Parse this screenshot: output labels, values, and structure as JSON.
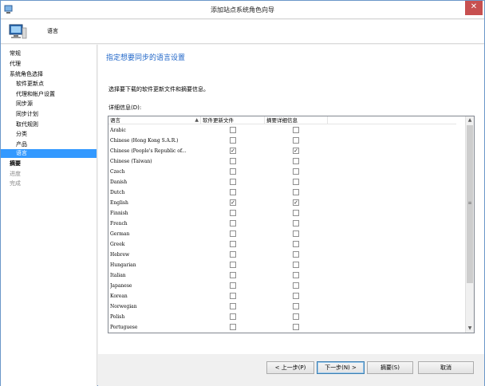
{
  "window": {
    "title": "添加站点系统角色向导"
  },
  "header": {
    "title": "语言"
  },
  "nav": {
    "items": [
      {
        "label": "常规",
        "level": "top",
        "state": "normal"
      },
      {
        "label": "代理",
        "level": "top",
        "state": "normal"
      },
      {
        "label": "系统角色选择",
        "level": "top",
        "state": "normal"
      },
      {
        "label": "软件更新点",
        "level": "sub",
        "state": "normal"
      },
      {
        "label": "代理和帐户设置",
        "level": "sub",
        "state": "normal"
      },
      {
        "label": "同步源",
        "level": "sub",
        "state": "normal"
      },
      {
        "label": "同步计划",
        "level": "sub",
        "state": "normal"
      },
      {
        "label": "取代规则",
        "level": "sub",
        "state": "normal"
      },
      {
        "label": "分类",
        "level": "sub",
        "state": "normal"
      },
      {
        "label": "产品",
        "level": "sub",
        "state": "normal"
      },
      {
        "label": "语言",
        "level": "sub",
        "state": "active"
      },
      {
        "label": "摘要",
        "level": "top",
        "state": "bold"
      },
      {
        "label": "进度",
        "level": "top",
        "state": "disabled"
      },
      {
        "label": "完成",
        "level": "top",
        "state": "disabled"
      }
    ]
  },
  "main": {
    "title": "指定想要同步的语言设置",
    "description": "选择要下载的软件更新文件和摘要信息。",
    "details_label": "详细信息(D):",
    "columns": [
      "语言",
      "软件更新文件",
      "摘要详细信息"
    ],
    "languages": [
      {
        "name": "Arabic",
        "files": false,
        "summary": false
      },
      {
        "name": "Chinese (Hong Kong S.A.R.)",
        "files": false,
        "summary": false
      },
      {
        "name": "Chinese (People's Republic of...",
        "files": true,
        "summary": true
      },
      {
        "name": "Chinese (Taiwan)",
        "files": false,
        "summary": false
      },
      {
        "name": "Czech",
        "files": false,
        "summary": false
      },
      {
        "name": "Danish",
        "files": false,
        "summary": false
      },
      {
        "name": "Dutch",
        "files": false,
        "summary": false
      },
      {
        "name": "English",
        "files": true,
        "summary": true
      },
      {
        "name": "Finnish",
        "files": false,
        "summary": false
      },
      {
        "name": "French",
        "files": false,
        "summary": false
      },
      {
        "name": "German",
        "files": false,
        "summary": false
      },
      {
        "name": "Greek",
        "files": false,
        "summary": false
      },
      {
        "name": "Hebrew",
        "files": false,
        "summary": false
      },
      {
        "name": "Hungarian",
        "files": false,
        "summary": false
      },
      {
        "name": "Italian",
        "files": false,
        "summary": false
      },
      {
        "name": "Japanese",
        "files": false,
        "summary": false
      },
      {
        "name": "Korean",
        "files": false,
        "summary": false
      },
      {
        "name": "Norwegian",
        "files": false,
        "summary": false
      },
      {
        "name": "Polish",
        "files": false,
        "summary": false
      },
      {
        "name": "Portuguese",
        "files": false,
        "summary": false
      }
    ]
  },
  "footer": {
    "prev_label": "< 上一步(P)",
    "next_label": "下一步(N) >",
    "summary_label": "摘要(S)",
    "cancel_label": "取消"
  },
  "colors": {
    "accent": "#1f66c8",
    "selection": "#3399ff",
    "close": "#c75050"
  },
  "icons": {
    "title": "wizard-window-icon",
    "header": "computer-icon"
  }
}
